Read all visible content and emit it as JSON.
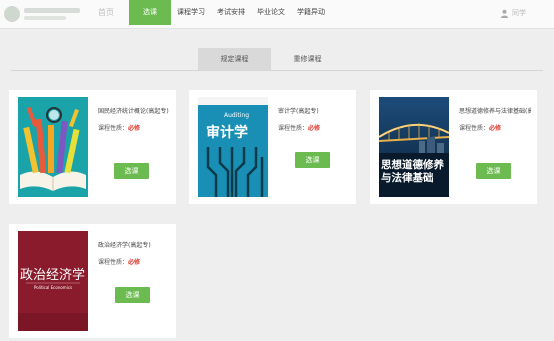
{
  "header": {
    "home_label": "首页",
    "user_name": "同学",
    "nav": [
      {
        "label": "选课"
      },
      {
        "label": "课程学习"
      },
      {
        "label": "考试安排"
      },
      {
        "label": "毕业论文"
      },
      {
        "label": "学籍异动"
      }
    ]
  },
  "tabs": [
    {
      "label": "规定课程"
    },
    {
      "label": "重修课程"
    }
  ],
  "courses": [
    {
      "title": "国民经济统计概论(高起专)",
      "type_label": "课程性质：",
      "type_value": "必修",
      "button": "选课",
      "cover_text": ""
    },
    {
      "title": "审计学(高起专)",
      "type_label": "课程性质：",
      "type_value": "必修",
      "button": "选课",
      "cover_text": "审计学",
      "cover_sub": "Auditing"
    },
    {
      "title": "思想道德修养与法律基础(高起专)",
      "type_label": "课程性质：",
      "type_value": "必修",
      "button": "选课",
      "cover_text": "思想道德修养与法律基础"
    },
    {
      "title": "政治经济学(高起专)",
      "type_label": "课程性质：",
      "type_value": "必修",
      "button": "选课",
      "cover_text": "政治经济学",
      "cover_sub": "Political Economics"
    }
  ],
  "colors": {
    "accent": "#6cbb51",
    "required": "#e03a2e",
    "page_bg": "#eeeeee"
  }
}
